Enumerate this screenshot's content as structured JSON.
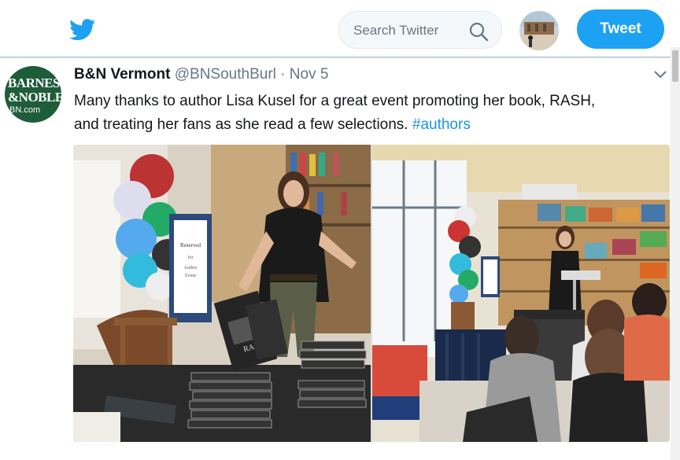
{
  "nav": {
    "search_placeholder": "Search Twitter",
    "tweet_button": "Tweet"
  },
  "tweet": {
    "avatar": {
      "line1": "BARNES",
      "line2": "&NOBLE",
      "line3": "BN.com"
    },
    "display_name": "B&N Vermont",
    "handle": "@BNSouthBurl",
    "separator": "·",
    "date": "Nov 5",
    "text_line1": "Many thanks to author Lisa Kusel for a great event promoting her book, RASH,",
    "text_line2": "and treating her fans as she read a few selections.",
    "hashtag": "#authors",
    "photo_left_sign": {
      "line1": "Reserved",
      "line2": "for",
      "line3": "Author",
      "line4": "Event"
    },
    "book_title": "RASH"
  },
  "colors": {
    "accent": "#1da1f2",
    "hashtag": "#1b95e0",
    "bn_green": "#1e5c3a",
    "muted": "#657786"
  }
}
